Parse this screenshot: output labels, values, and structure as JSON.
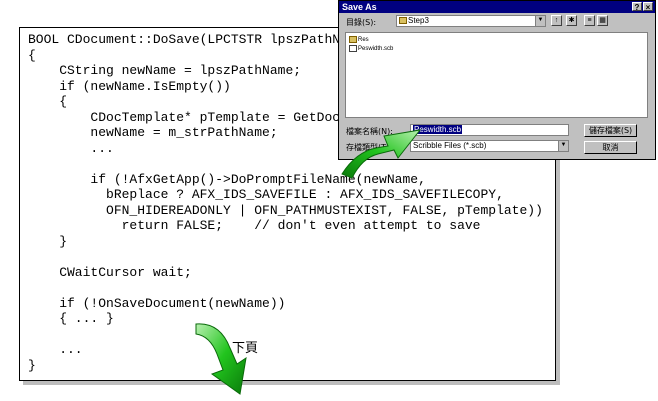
{
  "code": {
    "lines": [
      "BOOL CDocument::DoSave(LPCTSTR lpszPathN",
      "{",
      "    CString newName = lpszPathName;",
      "    if (newName.IsEmpty())",
      "    {",
      "        CDocTemplate* pTemplate = GetDoc",
      "        newName = m_strPathName;",
      "        ...",
      "",
      "        if (!AfxGetApp()->DoPromptFileName(newName,",
      "          bReplace ? AFX_IDS_SAVEFILE : AFX_IDS_SAVEFILECOPY,",
      "          OFN_HIDEREADONLY | OFN_PATHMUSTEXIST, FALSE, pTemplate))",
      "            return FALSE;    // don't even attempt to save",
      "    }",
      "",
      "    CWaitCursor wait;",
      "",
      "    if (!OnSaveDocument(newName))",
      "    { ... }",
      "",
      "    ...",
      "}"
    ]
  },
  "next_page_label": "下頁",
  "dialog": {
    "title": "Save As",
    "help_btn": "?",
    "close_btn": "×",
    "folder_label": "目錄(S):",
    "folder_value": "Step3",
    "files": [
      {
        "name": "Res",
        "icon": "folder-icon"
      },
      {
        "name": "Peswidth.scb",
        "icon": "file-icon"
      }
    ],
    "filename_label": "檔案名稱(N):",
    "filename_value": "Peswidth.scb",
    "filetype_label": "存檔類型(T):",
    "filetype_value": "Scribble Files (*.scb)",
    "save_button": "儲存檔案(S)",
    "cancel_button": "取消"
  },
  "colors": {
    "arrow": "#22c41e",
    "dialog_bg": "#c0c0c0",
    "title_bar": "#000080"
  }
}
